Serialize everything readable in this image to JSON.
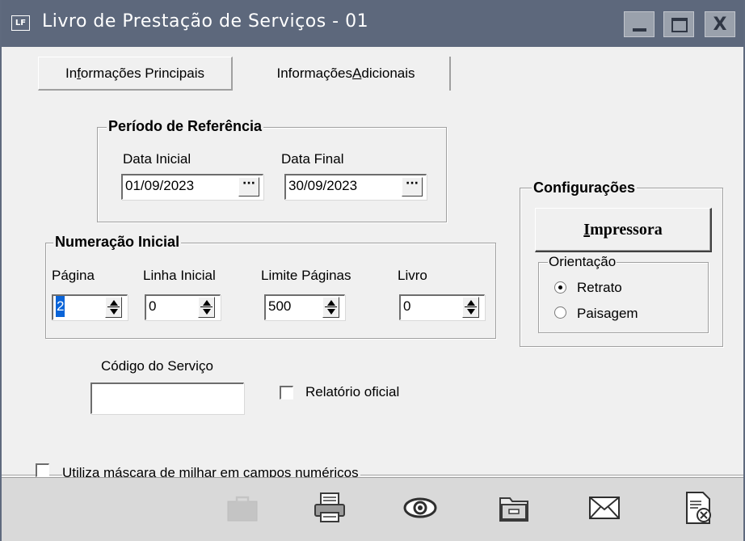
{
  "window": {
    "title": "Livro de Prestação de Serviços - 01",
    "app_icon_text": "LF",
    "close_glyph": "X"
  },
  "tabs": {
    "principais": {
      "prefix": "In",
      "accel": "f",
      "rest": "ormações Principais"
    },
    "adicionais": {
      "prefix": "Informações ",
      "accel": "A",
      "rest": "dicionais"
    }
  },
  "periodo": {
    "legend": "Período de Referência",
    "data_inicial_label": "Data Inicial",
    "data_inicial_value": "01/09/2023",
    "data_final_label": "Data Final",
    "data_final_value": "30/09/2023",
    "picker_glyph": "···"
  },
  "numeracao": {
    "legend": "Numeração Inicial",
    "pagina_label": "Página",
    "pagina_value": "2",
    "linha_label": "Linha Inicial",
    "linha_value": "0",
    "limite_label": "Limite Páginas",
    "limite_value": "500",
    "livro_label": "Livro",
    "livro_value": "0"
  },
  "servico": {
    "codigo_label": "Código do Serviço",
    "codigo_value": "",
    "relatorio_label": "Relatório oficial",
    "relatorio_checked": false
  },
  "configuracoes": {
    "legend": "Configurações",
    "impressora_accel": "I",
    "impressora_rest": "mpressora",
    "orientacao_legend": "Orientação",
    "retrato_label": "Retrato",
    "paisagem_label": "Paisagem",
    "selected": "Retrato"
  },
  "mascara": {
    "label": "Utiliza máscara de milhar em campos numéricos",
    "checked": false
  },
  "toolbar": {
    "icons": [
      "briefcase-icon",
      "printer-icon",
      "preview-eye-icon",
      "folder-icon",
      "mail-icon",
      "close-document-icon"
    ]
  }
}
